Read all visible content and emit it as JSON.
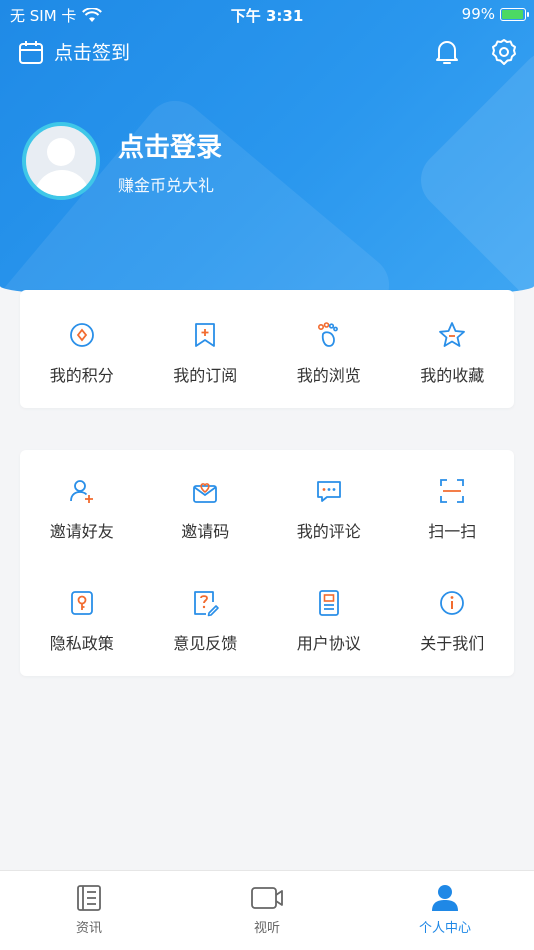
{
  "status_bar": {
    "carrier": "无 SIM 卡",
    "time": "下午 3:31",
    "battery": "99%"
  },
  "topbar": {
    "checkin_label": "点击签到"
  },
  "profile": {
    "login_label": "点击登录",
    "subtitle": "赚金币兑大礼"
  },
  "card1": [
    {
      "label": "我的积分",
      "icon": "points-icon"
    },
    {
      "label": "我的订阅",
      "icon": "subscription-icon"
    },
    {
      "label": "我的浏览",
      "icon": "footprint-icon"
    },
    {
      "label": "我的收藏",
      "icon": "star-icon"
    }
  ],
  "card2": [
    {
      "label": "邀请好友",
      "icon": "invite-friend-icon"
    },
    {
      "label": "邀请码",
      "icon": "invite-code-icon"
    },
    {
      "label": "我的评论",
      "icon": "comment-icon"
    },
    {
      "label": "扫一扫",
      "icon": "scan-icon"
    },
    {
      "label": "隐私政策",
      "icon": "privacy-icon"
    },
    {
      "label": "意见反馈",
      "icon": "feedback-icon"
    },
    {
      "label": "用户协议",
      "icon": "agreement-icon"
    },
    {
      "label": "关于我们",
      "icon": "about-icon"
    }
  ],
  "tabs": [
    {
      "label": "资讯",
      "icon": "news-icon",
      "active": false
    },
    {
      "label": "视听",
      "icon": "video-icon",
      "active": false
    },
    {
      "label": "个人中心",
      "icon": "person-icon",
      "active": true
    }
  ],
  "colors": {
    "primary": "#1f88e6",
    "accent_orange": "#f26b2f",
    "icon_blue": "#2a8fe8"
  }
}
